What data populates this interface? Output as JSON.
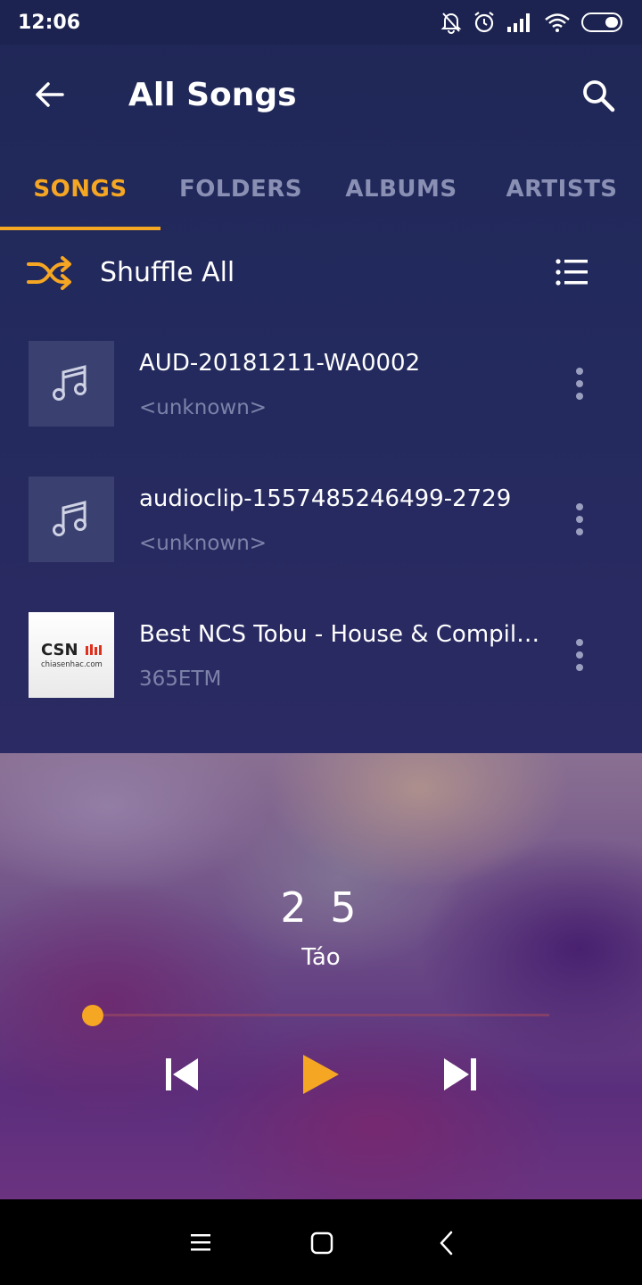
{
  "status_bar": {
    "time": "12:06",
    "icons": [
      "bell-off-icon",
      "alarm-icon",
      "signal-icon",
      "wifi-icon",
      "battery-icon"
    ]
  },
  "header": {
    "title": "All Songs",
    "back_icon": "arrow-left-icon",
    "search_icon": "search-icon"
  },
  "tabs": [
    {
      "label": "SONGS",
      "active": true
    },
    {
      "label": "FOLDERS",
      "active": false
    },
    {
      "label": "ALBUMS",
      "active": false
    },
    {
      "label": "ARTISTS",
      "active": false
    }
  ],
  "shuffle": {
    "label": "Shuffle All",
    "icon": "shuffle-icon",
    "list_icon": "list-view-icon"
  },
  "songs": [
    {
      "title": "AUD-20181211-WA0002",
      "artist": "<unknown>",
      "thumb": "music-note-icon"
    },
    {
      "title": "audioclip-1557485246499-2729",
      "artist": "<unknown>",
      "thumb": "music-note-icon"
    },
    {
      "title": "Best NCS Tobu - House & Compilation",
      "artist": "365ETM",
      "thumb": "csn-logo",
      "thumb_text": "CSN",
      "thumb_subtext": "chiasenhac.com"
    }
  ],
  "player": {
    "song_number": "2 5",
    "artist": "Táo",
    "progress": 0.0,
    "controls": [
      "skip-previous-icon",
      "play-icon",
      "skip-next-icon"
    ]
  },
  "colors": {
    "accent": "#f5a623",
    "background": "#1f2757",
    "muted_text": "#7c82a8"
  },
  "nav_bar": {
    "icons": [
      "menu-icon",
      "home-icon",
      "back-icon"
    ]
  }
}
